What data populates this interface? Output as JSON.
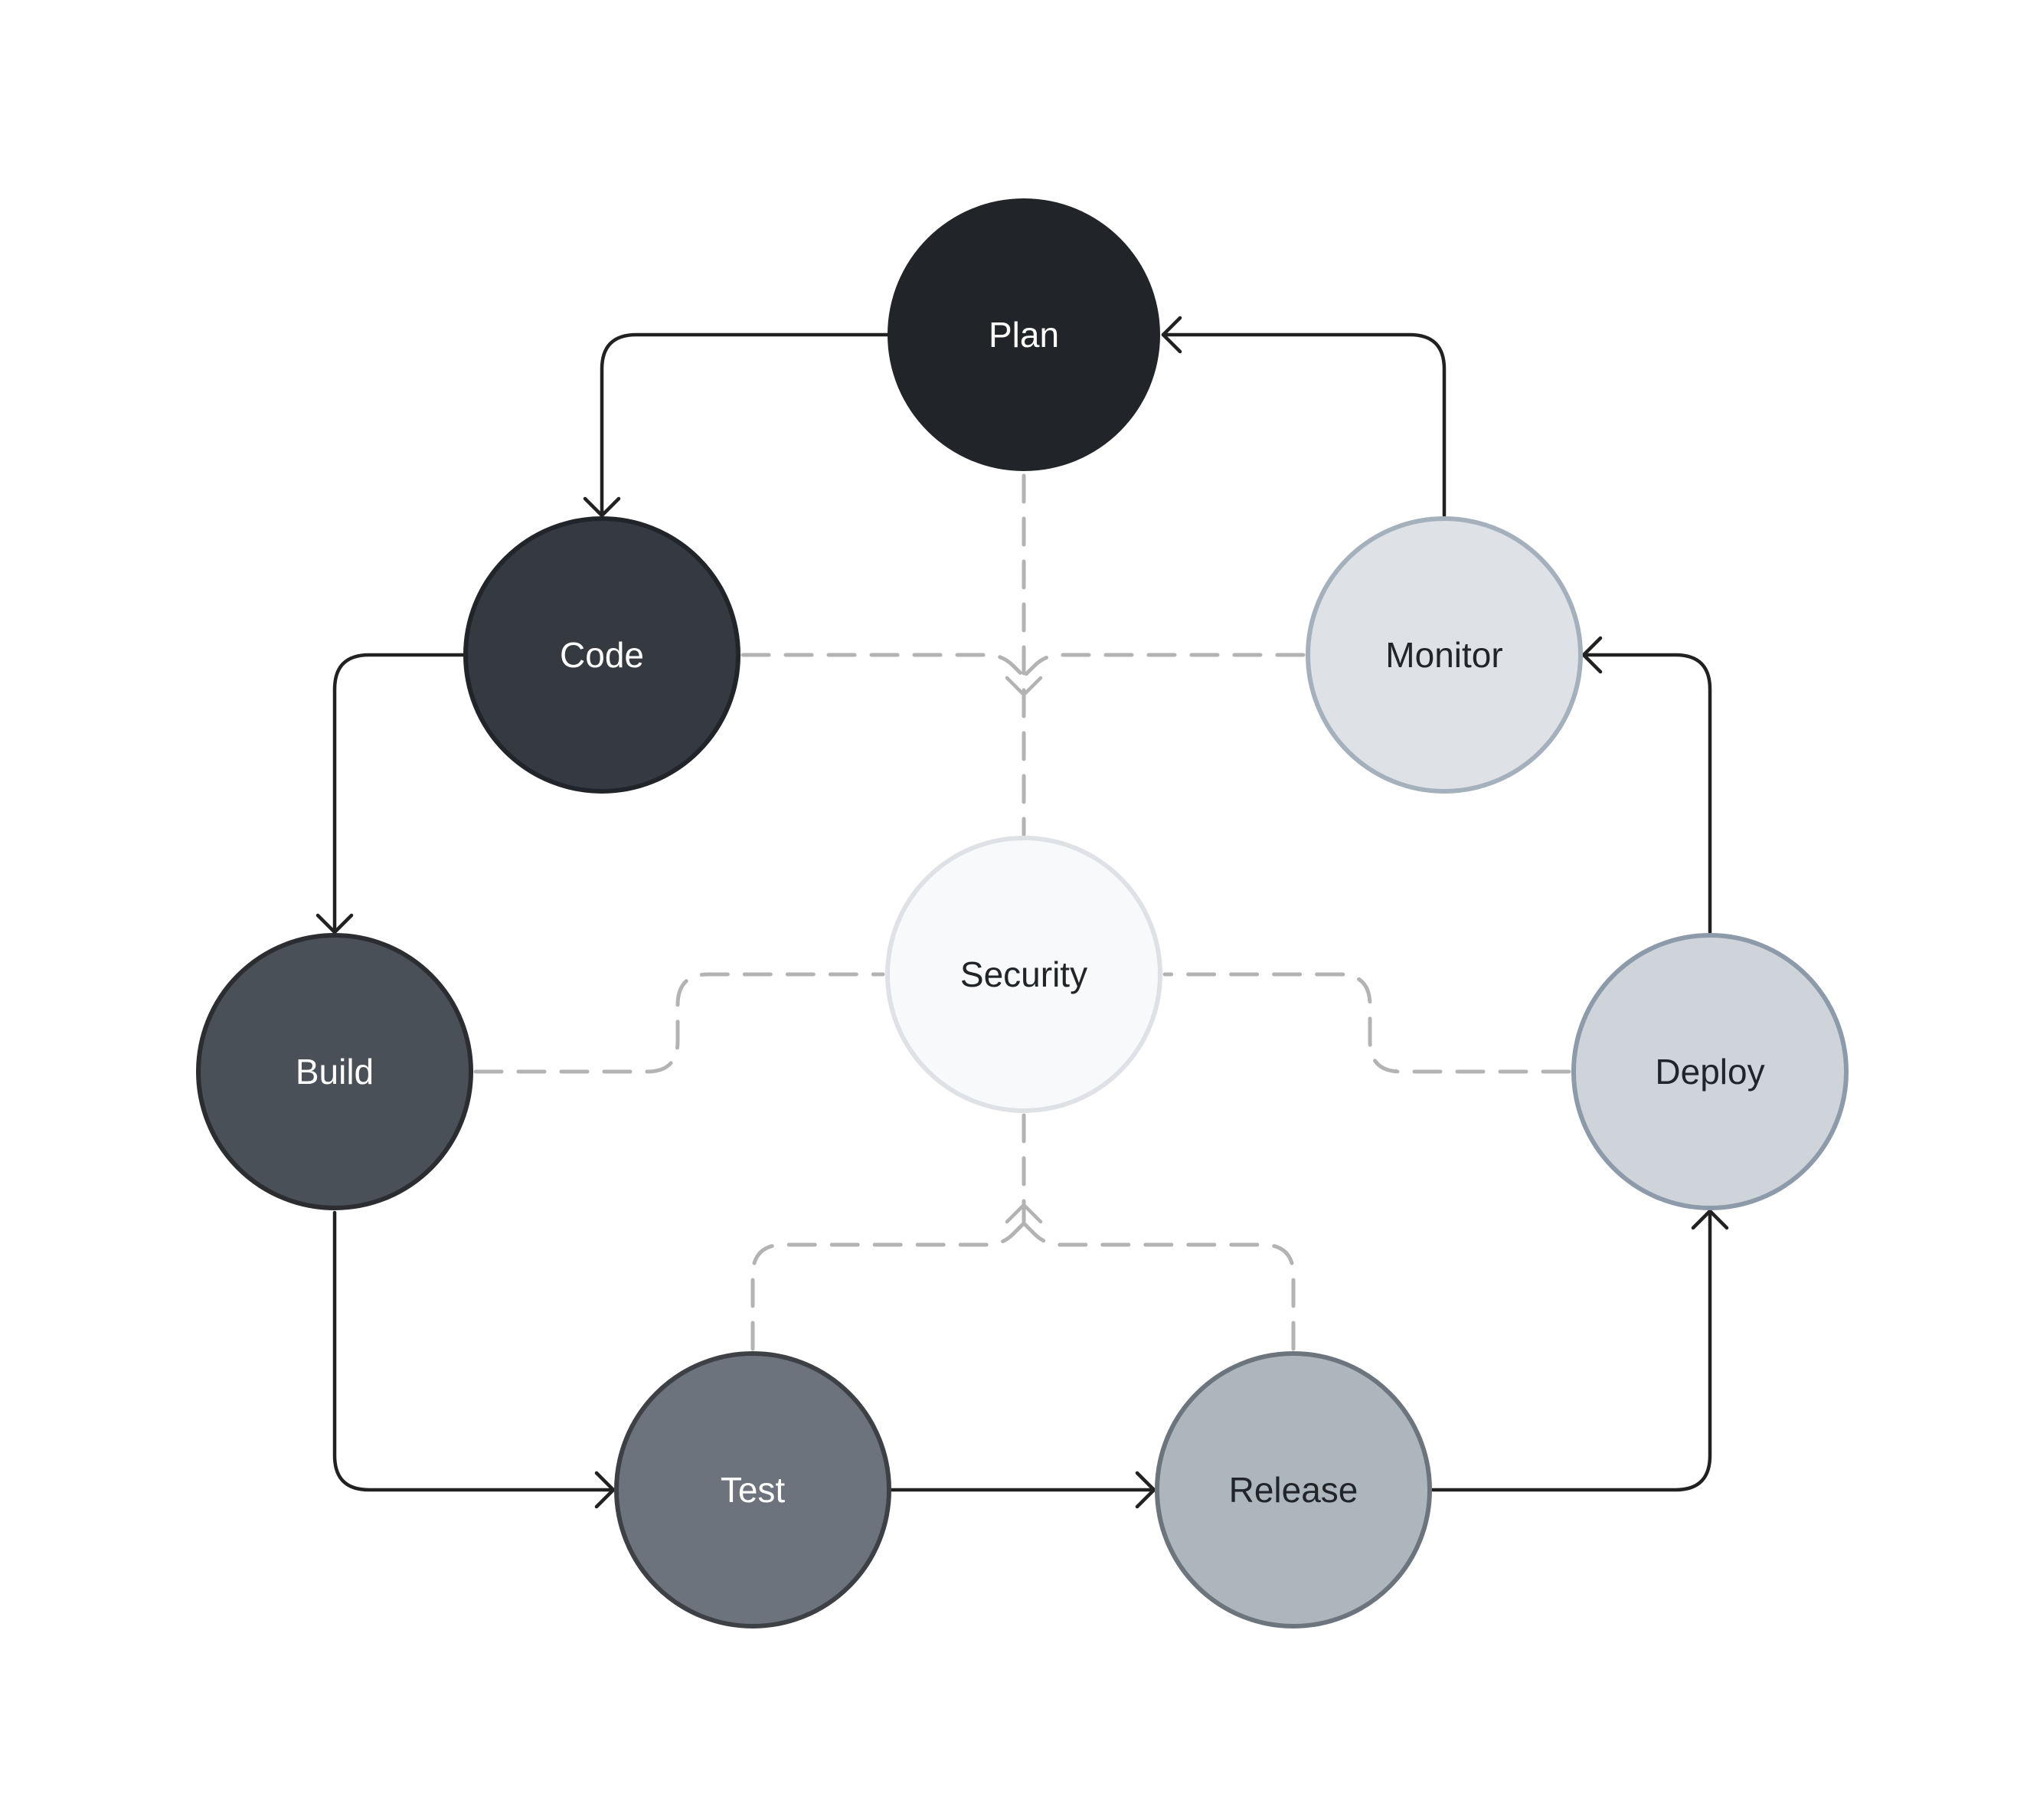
{
  "diagram": {
    "type": "devsecops-cycle",
    "nodes": [
      {
        "id": "plan",
        "label": "Plan",
        "fill": "#212529",
        "stroke": "#212529",
        "text_color": "#ffffff"
      },
      {
        "id": "code",
        "label": "Code",
        "fill": "#343a40",
        "stroke": "#212529",
        "text_color": "#ffffff"
      },
      {
        "id": "build",
        "label": "Build",
        "fill": "#495057",
        "stroke": "#2b2d31",
        "text_color": "#ffffff"
      },
      {
        "id": "test",
        "label": "Test",
        "fill": "#6c737d",
        "stroke": "#3d4146",
        "text_color": "#ffffff"
      },
      {
        "id": "release",
        "label": "Release",
        "fill": "#adb5bd",
        "stroke": "#6c757d",
        "text_color": "#212529"
      },
      {
        "id": "deploy",
        "label": "Deploy",
        "fill": "#ced4da",
        "stroke": "#8d9aaa",
        "text_color": "#212529"
      },
      {
        "id": "monitor",
        "label": "Monitor",
        "fill": "#dee2e6",
        "stroke": "#a5b0bd",
        "text_color": "#212529"
      },
      {
        "id": "security",
        "label": "Security",
        "fill": "#f8f9fa",
        "stroke": "#dee2e6",
        "text_color": "#212529"
      }
    ],
    "flow_edges": [
      {
        "from": "plan",
        "to": "code",
        "style": "solid",
        "color": "#212121"
      },
      {
        "from": "code",
        "to": "build",
        "style": "solid",
        "color": "#212121"
      },
      {
        "from": "build",
        "to": "test",
        "style": "solid",
        "color": "#212121"
      },
      {
        "from": "test",
        "to": "release",
        "style": "solid",
        "color": "#212121"
      },
      {
        "from": "release",
        "to": "deploy",
        "style": "solid",
        "color": "#212121"
      },
      {
        "from": "deploy",
        "to": "monitor",
        "style": "solid",
        "color": "#212121"
      },
      {
        "from": "monitor",
        "to": "plan",
        "style": "solid",
        "color": "#212121"
      }
    ],
    "security_edges": [
      {
        "from": "plan",
        "to": "security",
        "style": "dashed",
        "color": "#b3b3b3"
      },
      {
        "from": "code",
        "to": "security",
        "style": "dashed",
        "color": "#b3b3b3"
      },
      {
        "from": "monitor",
        "to": "security",
        "style": "dashed",
        "color": "#b3b3b3"
      },
      {
        "from": "build",
        "to": "security",
        "style": "dashed",
        "color": "#b3b3b3"
      },
      {
        "from": "deploy",
        "to": "security",
        "style": "dashed",
        "color": "#b3b3b3"
      },
      {
        "from": "test",
        "to": "security",
        "style": "dashed",
        "color": "#b3b3b3"
      },
      {
        "from": "release",
        "to": "security",
        "style": "dashed",
        "color": "#b3b3b3"
      }
    ]
  }
}
